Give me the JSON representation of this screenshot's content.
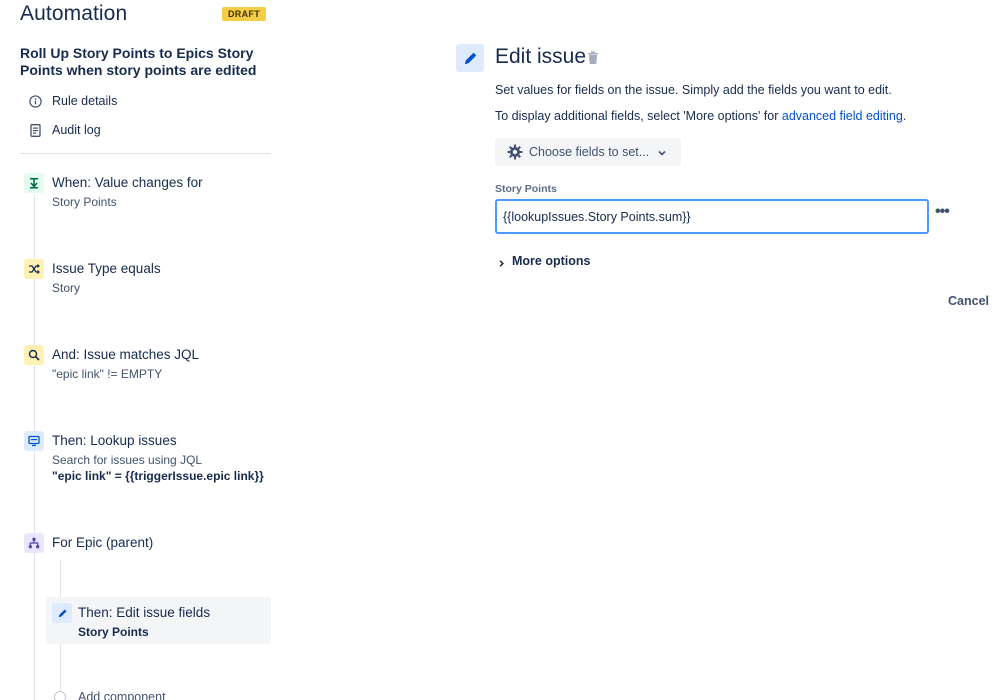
{
  "header": {
    "title": "Automation",
    "badge": "DRAFT"
  },
  "rule": {
    "name": "Roll Up Story Points to Epics Story Points when story points are edited"
  },
  "sidebar_links": {
    "rule_details": "Rule details",
    "audit_log": "Audit log"
  },
  "steps": {
    "trigger": {
      "title": "When: Value changes for",
      "subtitle": "Story Points"
    },
    "condition_type": {
      "title": "Issue Type equals",
      "subtitle": "Story"
    },
    "condition_jql": {
      "title": "And: Issue matches JQL",
      "subtitle": "\"epic link\" != EMPTY"
    },
    "lookup": {
      "title": "Then: Lookup issues",
      "subtitle": "Search for issues using JQL",
      "query": "\"epic link\" = {{triggerIssue.epic link}}"
    },
    "branch": {
      "title": "For Epic (parent)"
    },
    "edit_fields": {
      "title": "Then: Edit issue fields",
      "subtitle": "Story Points"
    },
    "add_component": "Add component"
  },
  "editor": {
    "title": "Edit issue",
    "description": "Set values for fields on the issue. Simply add the fields you want to edit.",
    "more_fields_prefix": "To display additional fields, select 'More options' for ",
    "more_fields_link": "advanced field editing",
    "more_fields_suffix": ".",
    "choose_fields_label": "Choose fields to set...",
    "field_label": "Story Points",
    "field_value": "{{lookupIssues.Story Points.sum}}",
    "more_options_label": "More options",
    "cancel_label": "Cancel",
    "more_actions_label": "•••"
  },
  "colors": {
    "accent": "#0052cc",
    "draft_badge": "#f5cd47",
    "trigger_icon_bg": "#e3fcef",
    "condition_icon_bg": "#fff0b3",
    "action_icon_bg": "#deebff",
    "branch_icon_bg": "#eae6ff"
  },
  "icons": {
    "rule_details": "info-icon",
    "audit_log": "document-icon",
    "trigger": "trigger-icon",
    "condition_type": "shuffle-icon",
    "condition_jql": "search-icon",
    "lookup": "monitor-icon",
    "branch": "hierarchy-icon",
    "edit": "pencil-icon",
    "trash": "trash-icon",
    "choose": "gear-icon"
  }
}
